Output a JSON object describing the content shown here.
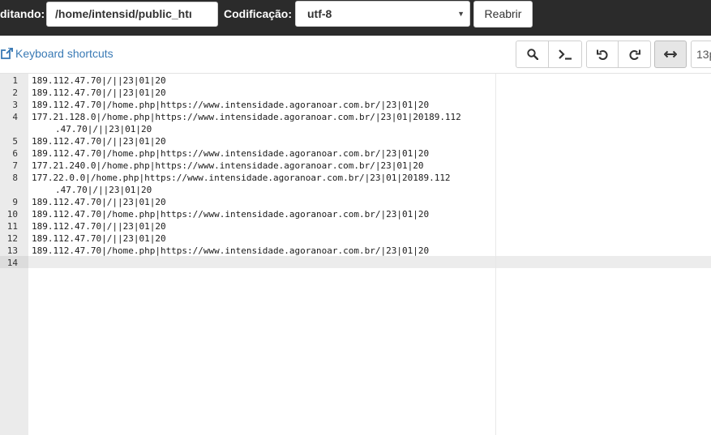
{
  "header": {
    "editing_label": "ditando:",
    "path_value": "/home/intensid/public_htı",
    "encoding_label": "Codificação:",
    "encoding_value": "utf-8",
    "reopen_label": "Reabrir"
  },
  "toolbar": {
    "shortcuts_label": "Keyboard shortcuts",
    "font_size_value": "13p"
  },
  "icons": {
    "external_link": "external-link-icon",
    "search": "search-icon",
    "terminal": "terminal-icon",
    "undo": "undo-icon",
    "redo": "redo-icon",
    "wrap": "wrap-horizontal-arrows-icon"
  },
  "colors": {
    "topbar_bg": "#2b2b2b",
    "link": "#3a7ab5",
    "gutter_bg": "#ebebeb",
    "active_line": "#ececec"
  },
  "editor": {
    "lines": [
      {
        "n": "1",
        "parts": [
          "189.112.47.70|/||23|01|20"
        ]
      },
      {
        "n": "2",
        "parts": [
          "189.112.47.70|/||23|01|20"
        ]
      },
      {
        "n": "3",
        "parts": [
          "189.112.47.70|/home.php|https://www.intensidade.agoranoar.com.br/|23|01|20"
        ]
      },
      {
        "n": "4",
        "parts": [
          "177.21.128.0|/home.php|https://www.intensidade.agoranoar.com.br/|23|01|20189.112",
          ".47.70|/||23|01|20"
        ]
      },
      {
        "n": "5",
        "parts": [
          "189.112.47.70|/||23|01|20"
        ]
      },
      {
        "n": "6",
        "parts": [
          "189.112.47.70|/home.php|https://www.intensidade.agoranoar.com.br/|23|01|20"
        ]
      },
      {
        "n": "7",
        "parts": [
          "177.21.240.0|/home.php|https://www.intensidade.agoranoar.com.br/|23|01|20"
        ]
      },
      {
        "n": "8",
        "parts": [
          "177.22.0.0|/home.php|https://www.intensidade.agoranoar.com.br/|23|01|20189.112",
          ".47.70|/||23|01|20"
        ]
      },
      {
        "n": "9",
        "parts": [
          "189.112.47.70|/||23|01|20"
        ]
      },
      {
        "n": "10",
        "parts": [
          "189.112.47.70|/home.php|https://www.intensidade.agoranoar.com.br/|23|01|20"
        ]
      },
      {
        "n": "11",
        "parts": [
          "189.112.47.70|/||23|01|20"
        ]
      },
      {
        "n": "12",
        "parts": [
          "189.112.47.70|/||23|01|20"
        ]
      },
      {
        "n": "13",
        "parts": [
          "189.112.47.70|/home.php|https://www.intensidade.agoranoar.com.br/|23|01|20"
        ]
      },
      {
        "n": "14",
        "parts": [
          ""
        ]
      }
    ]
  }
}
